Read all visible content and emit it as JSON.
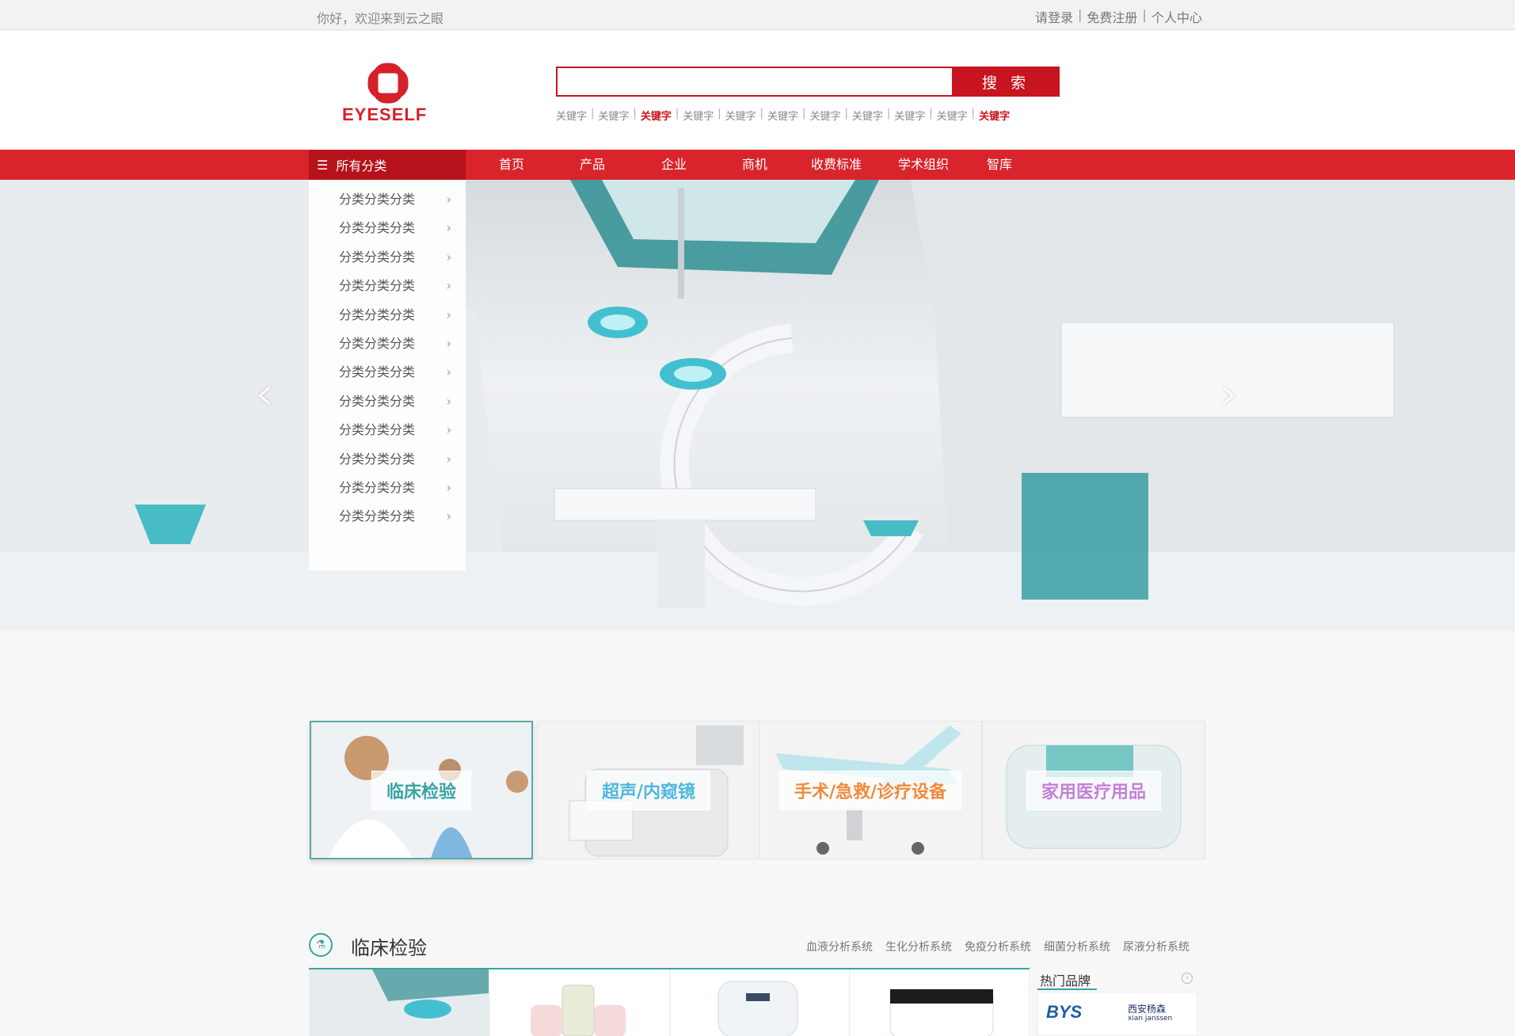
{
  "topbar": {
    "welcome": "你好，欢迎来到云之眼",
    "links": [
      "请登录",
      "免费注册",
      "个人中心"
    ]
  },
  "header": {
    "logo_text": "EYESELF",
    "search_placeholder": "",
    "search_button": "搜 索",
    "keywords": [
      {
        "text": "关键字",
        "hot": false
      },
      {
        "text": "关键字",
        "hot": false
      },
      {
        "text": "关键字",
        "hot": true
      },
      {
        "text": "关键字",
        "hot": false
      },
      {
        "text": "关键字",
        "hot": false
      },
      {
        "text": "关键字",
        "hot": false
      },
      {
        "text": "关键字",
        "hot": false
      },
      {
        "text": "关键字",
        "hot": false
      },
      {
        "text": "关键字",
        "hot": false
      },
      {
        "text": "关键字",
        "hot": false
      },
      {
        "text": "关键字",
        "hot": true
      }
    ]
  },
  "nav": {
    "all_categories": "所有分类",
    "items": [
      "首页",
      "产品",
      "企业",
      "商机",
      "收费标准",
      "学术组织",
      "智库"
    ]
  },
  "categories": [
    "分类分类分类",
    "分类分类分类",
    "分类分类分类",
    "分类分类分类",
    "分类分类分类",
    "分类分类分类",
    "分类分类分类",
    "分类分类分类",
    "分类分类分类",
    "分类分类分类",
    "分类分类分类",
    "分类分类分类"
  ],
  "tiles": [
    {
      "label": "临床检验",
      "color": "#3aa3a3"
    },
    {
      "label": "超声/内窥镜",
      "color": "#4fb7df"
    },
    {
      "label": "手术/急救/诊疗设备",
      "color": "#f08a3a"
    },
    {
      "label": "家用医疗用品",
      "color": "#c47fd8"
    }
  ],
  "section": {
    "title": "临床检验",
    "sublinks": [
      "血液分析系统",
      "生化分析系统",
      "免疫分析系统",
      "细菌分析系统",
      "尿液分析系统"
    ],
    "brands_title": "热门品牌",
    "brands": [
      "BYS",
      "西安杨森",
      "xian janssen"
    ]
  },
  "colors": {
    "brand_red": "#d9242c",
    "dark_red": "#b5121c",
    "teal": "#3aa3a3"
  }
}
